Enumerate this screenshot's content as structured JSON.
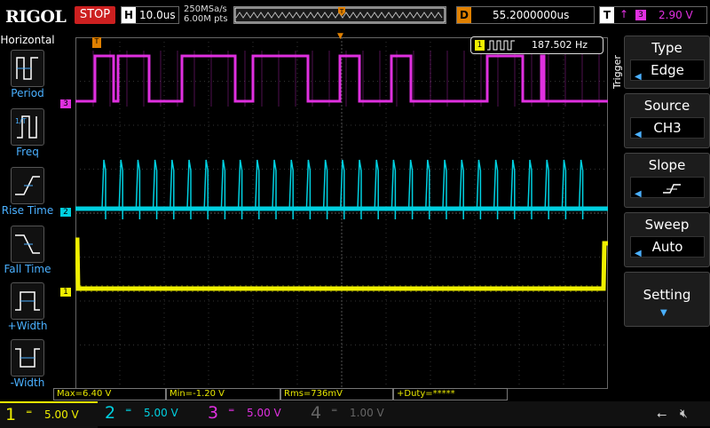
{
  "topbar": {
    "logo": "RIGOL",
    "run_state": "STOP",
    "h_letter": "H",
    "timebase": "10.0us",
    "sample_rate": "250MSa/s",
    "memory_depth": "6.00M pts",
    "d_letter": "D",
    "delay": "55.2000000us",
    "t_letter": "T",
    "trigger_edge_glyph": "↑",
    "trigger_source_num": "3",
    "trigger_level": "2.90 V"
  },
  "left_panel": {
    "title": "Horizontal",
    "buttons": [
      {
        "label": "Period",
        "icon": "period-icon"
      },
      {
        "label": "Freq",
        "icon": "frequency-icon"
      },
      {
        "label": "Rise Time",
        "icon": "rise-time-icon"
      },
      {
        "label": "Fall Time",
        "icon": "fall-time-icon"
      },
      {
        "label": "+Width",
        "icon": "positive-width-icon"
      },
      {
        "label": "-Width",
        "icon": "negative-width-icon"
      }
    ]
  },
  "freq_counter": {
    "channel": "1",
    "value": "187.502 Hz"
  },
  "channel_markers": {
    "ch1": "1",
    "ch2": "2",
    "ch3": "3"
  },
  "right_menu": {
    "trigger_label": "Trigger",
    "type_title": "Type",
    "type_value": "Edge",
    "source_title": "Source",
    "source_value": "CH3",
    "slope_title": "Slope",
    "sweep_title": "Sweep",
    "sweep_value": "Auto",
    "setting_title": "Setting"
  },
  "measurements": {
    "max": "Max=6.40 V",
    "min": "Min=-1.20 V",
    "rms": "Rms=736mV",
    "duty": "+Duty=*****"
  },
  "channels": [
    {
      "num": "1",
      "scale": "5.00 V",
      "color": "#f0f000"
    },
    {
      "num": "2",
      "scale": "5.00 V",
      "color": "#00d0e0"
    },
    {
      "num": "3",
      "scale": "5.00 V",
      "color": "#e030e0"
    },
    {
      "num": "4",
      "scale": "1.00 V",
      "color": "#666666"
    }
  ],
  "colors": {
    "ch1": "#f0f000",
    "ch2": "#00d0e0",
    "ch3": "#e030e0",
    "trigger_marker": "#e08000",
    "menu_accent": "#4ab0ff"
  }
}
